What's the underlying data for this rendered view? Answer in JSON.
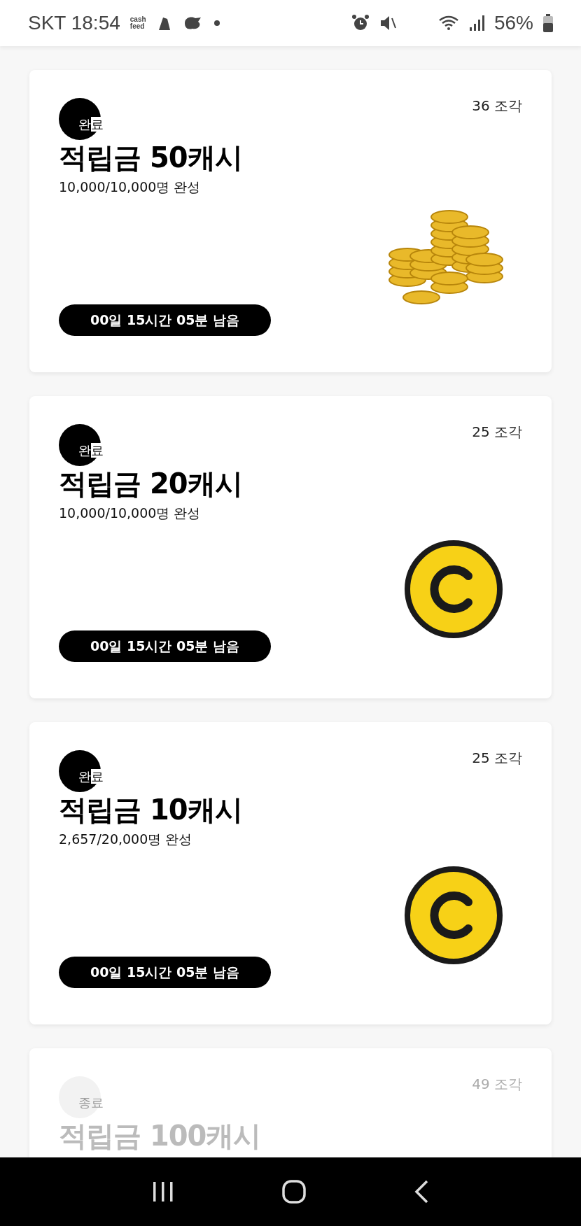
{
  "status_bar": {
    "carrier_time": "SKT 18:54",
    "app_logo": [
      "cash",
      "feed"
    ],
    "battery": "56%"
  },
  "cards": [
    {
      "kind": "coin-pile",
      "disabled": false,
      "badge": "완료",
      "pieces": "36 조각",
      "title": "적립금 50캐시",
      "progress": "10,000/10,000명 완성",
      "timer": "00일 15시간 05분 남음"
    },
    {
      "kind": "c-coin",
      "disabled": false,
      "badge": "완료",
      "pieces": "25 조각",
      "title": "적립금 20캐시",
      "progress": "10,000/10,000명 완성",
      "timer": "00일 15시간 05분 남음"
    },
    {
      "kind": "c-coin",
      "disabled": false,
      "badge": "완료",
      "pieces": "25 조각",
      "title": "적립금 10캐시",
      "progress": "2,657/20,000명 완성",
      "timer": "00일 15시간 05분 남음"
    },
    {
      "kind": "none",
      "disabled": true,
      "badge": "종료",
      "pieces": "49 조각",
      "title": "적립금 100캐시"
    }
  ]
}
